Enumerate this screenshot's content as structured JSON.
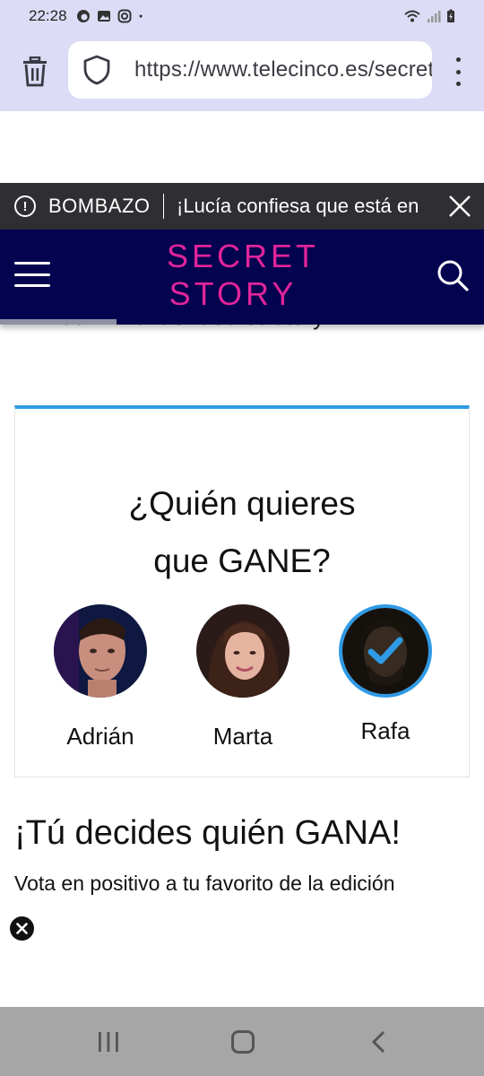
{
  "status_bar": {
    "time": "22:28",
    "left_icons": [
      "firefox-icon",
      "gallery-icon",
      "instagram-icon",
      "dot-icon"
    ],
    "right_icons": [
      "wifi-icon",
      "signal-icon",
      "battery-charging-icon"
    ]
  },
  "browser": {
    "url": "https://www.telecinco.es/secretstory",
    "icons": [
      "trash-icon",
      "shield-icon",
      "more-vert-icon"
    ]
  },
  "article": {
    "behind_header_text": "semifinal de 'Secret Story'"
  },
  "breaking_bar": {
    "label": "BOMBAZO",
    "headline": "¡Lucía confiesa que está en",
    "icons": [
      "alert-circle-icon",
      "close-icon"
    ]
  },
  "site_header": {
    "logo_line1": "SECRET",
    "logo_line2": "STORY",
    "icons": [
      "hamburger-icon",
      "search-icon"
    ],
    "colors": {
      "background": "#04034f",
      "logo": "#e0249a"
    }
  },
  "poll": {
    "title_line1": "¿Quién quieres",
    "title_line2": "que GANE?",
    "candidates": [
      {
        "name": "Adrián",
        "selected": false
      },
      {
        "name": "Marta",
        "selected": false
      },
      {
        "name": "Rafa",
        "selected": true
      }
    ],
    "colors": {
      "accent": "#2f9ae6"
    }
  },
  "section": {
    "title": "¡Tú decides quién GANA!",
    "subtitle": "Vota en positivo a tu favorito de la edición"
  },
  "nav_bar": {
    "icons": [
      "recent-apps-icon",
      "home-icon",
      "back-icon"
    ]
  }
}
